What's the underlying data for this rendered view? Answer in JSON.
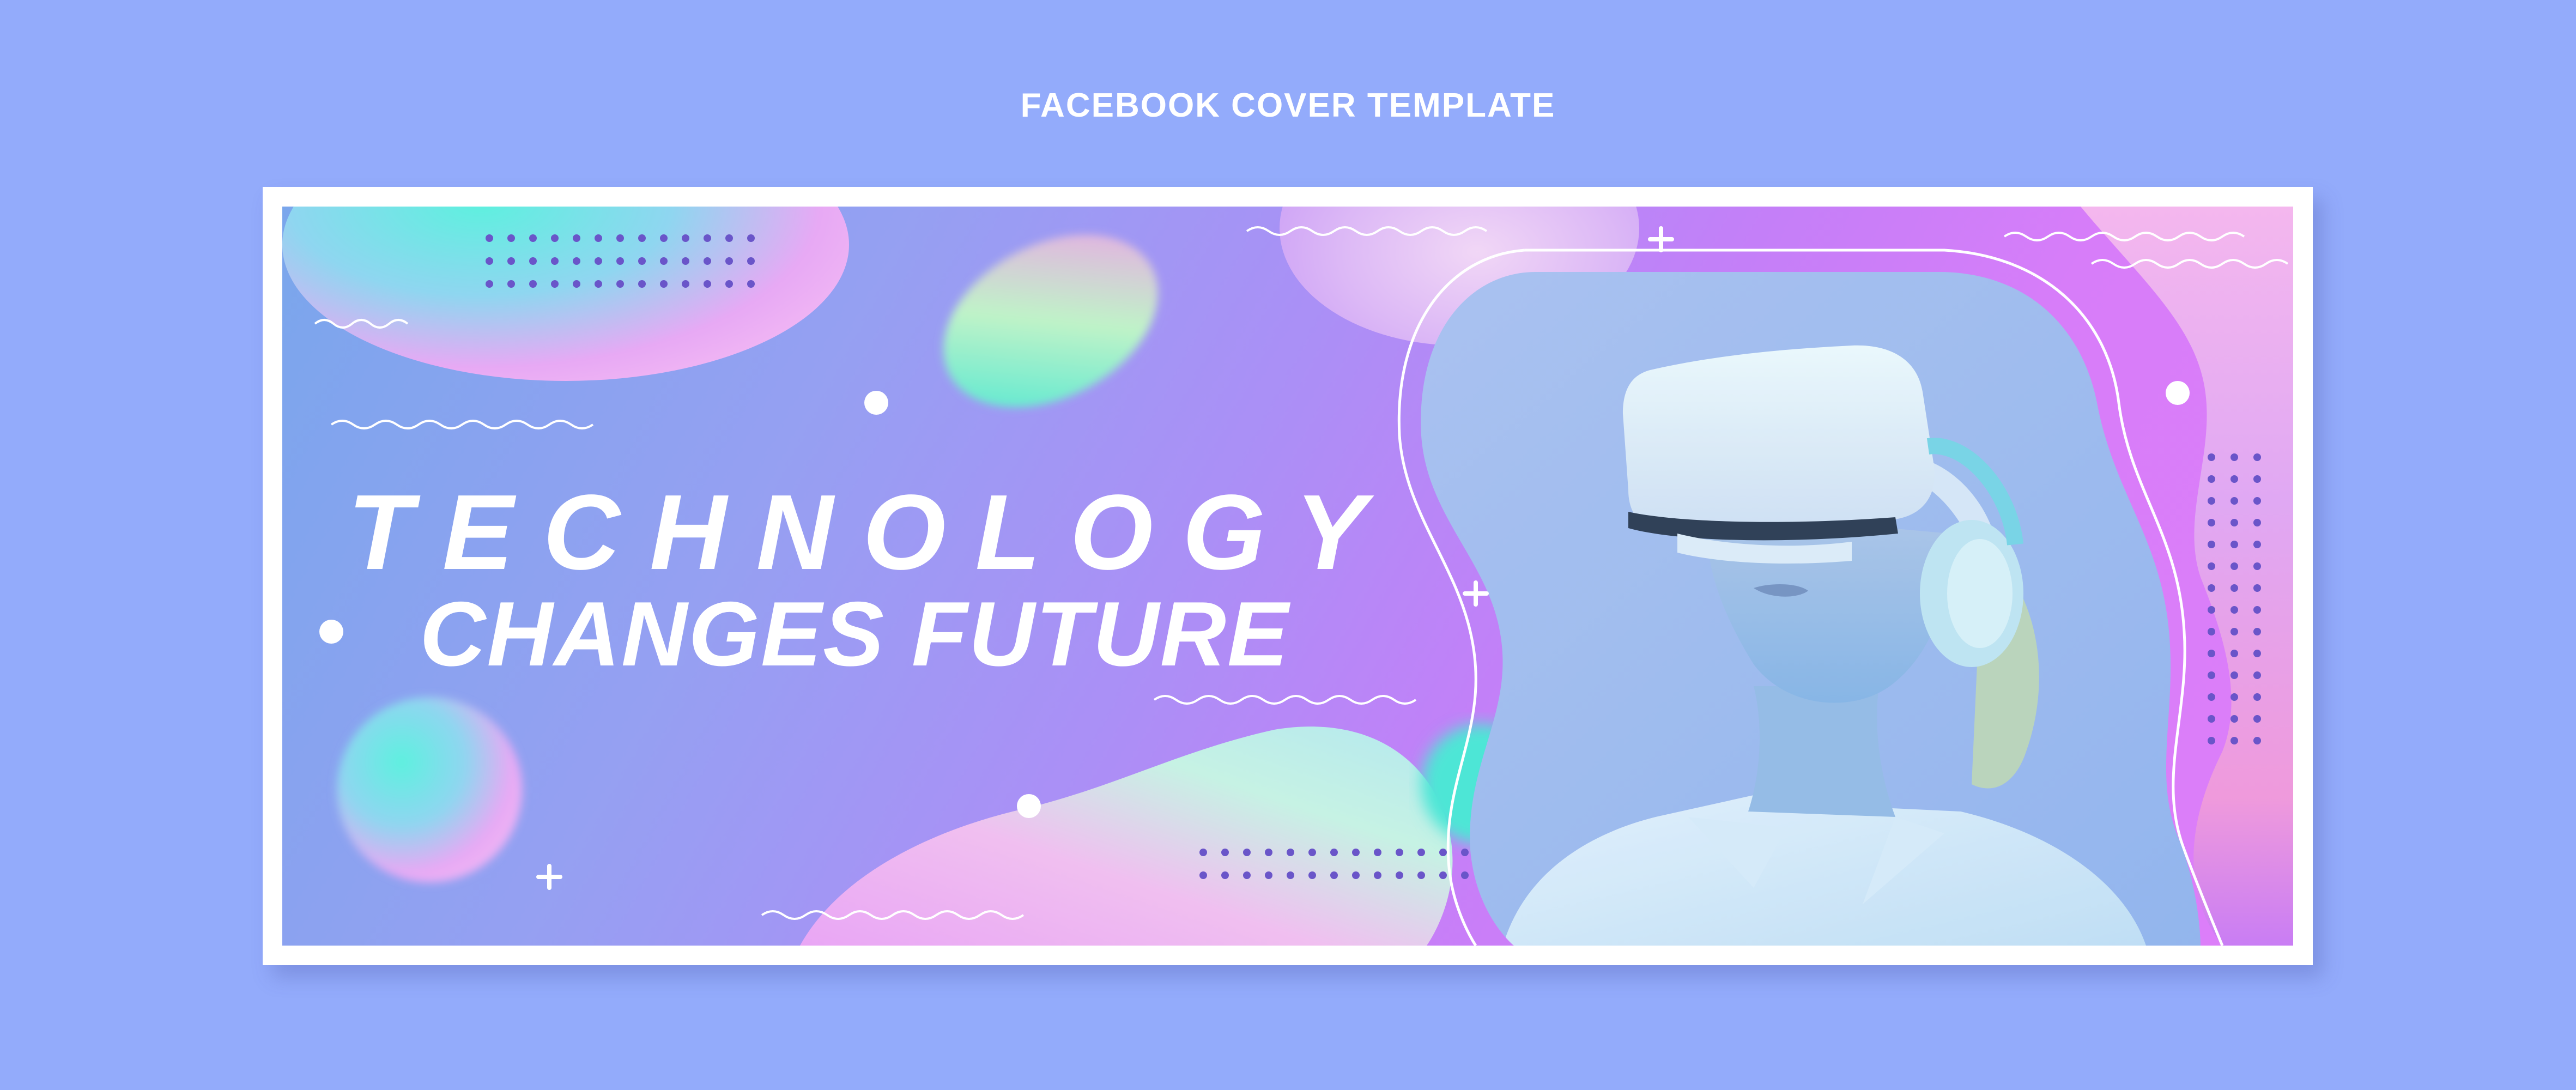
{
  "page": {
    "heading": "FACEBOOK COVER TEMPLATE",
    "background_color": "#93abfb"
  },
  "cover": {
    "headline_line1": "TECHNOLOGY",
    "headline_line2": "CHANGES FUTURE",
    "frame_color": "#ffffff",
    "gradient_colors": [
      "#7aa6ec",
      "#ab8ff6",
      "#dd7ef9"
    ],
    "photo": {
      "subject": "woman wearing white VR headset and headphones",
      "icon": "vr-headset-icon"
    },
    "decorations": {
      "plus_icon": "plus-icon",
      "dot_icon": "dot-icon",
      "wave_icon": "wave-line-icon",
      "dot_grid_icon": "dot-grid-icon"
    }
  }
}
